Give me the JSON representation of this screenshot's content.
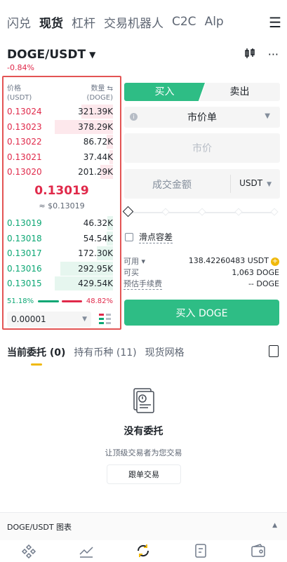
{
  "nav": {
    "tabs": [
      "闪兑",
      "现货",
      "杠杆",
      "交易机器人",
      "C2C",
      "Alp"
    ],
    "active": "现货"
  },
  "pair": {
    "symbol": "DOGE/USDT",
    "change": "-0.84%"
  },
  "orderbook": {
    "price_label": "价格",
    "price_unit": "(USDT)",
    "qty_label": "数量 ⇆",
    "qty_unit": "(DOGE)",
    "asks": [
      {
        "price": "0.13024",
        "amount": "321.39K",
        "depth": 0.3
      },
      {
        "price": "0.13023",
        "amount": "378.29K",
        "depth": 0.55
      },
      {
        "price": "0.13022",
        "amount": "86.72K",
        "depth": 0.06
      },
      {
        "price": "0.13021",
        "amount": "37.44K",
        "depth": 0.03
      },
      {
        "price": "0.13020",
        "amount": "201.29K",
        "depth": 0.12
      }
    ],
    "last_price": "0.13019",
    "last_usd": "≈ $0.13019",
    "bids": [
      {
        "price": "0.13019",
        "amount": "46.32K",
        "depth": 0.05
      },
      {
        "price": "0.13018",
        "amount": "54.54K",
        "depth": 0.06
      },
      {
        "price": "0.13017",
        "amount": "172.30K",
        "depth": 0.15
      },
      {
        "price": "0.13016",
        "amount": "292.95K",
        "depth": 0.5
      },
      {
        "price": "0.13015",
        "amount": "429.54K",
        "depth": 0.55
      }
    ],
    "buy_ratio": "51.18%",
    "sell_ratio": "48.82%",
    "precision": "0.00001"
  },
  "trade": {
    "buy_tab": "买入",
    "sell_tab": "卖出",
    "order_type": "市价单",
    "price_placeholder": "市价",
    "total_placeholder": "成交金额",
    "total_unit": "USDT",
    "slippage": "滑点容差",
    "available_label": "可用",
    "available_value": "138.42260483 USDT",
    "can_buy_label": "可买",
    "can_buy_value": "1,063 DOGE",
    "fee_label": "预估手续费",
    "fee_value": "-- DOGE",
    "buy_button": "买入 DOGE"
  },
  "orders": {
    "tabs": [
      "当前委托 (0)",
      "持有币种 (11)",
      "现货网格"
    ],
    "empty_title": "没有委托",
    "empty_sub": "让顶级交易者为您交易",
    "follow_button": "跟单交易"
  },
  "chart_bar": {
    "label": "DOGE/USDT 图表"
  },
  "colors": {
    "ask": "#e0294a",
    "bid": "#0ca774",
    "buy": "#2ebd85",
    "accent": "#f0b90b"
  }
}
